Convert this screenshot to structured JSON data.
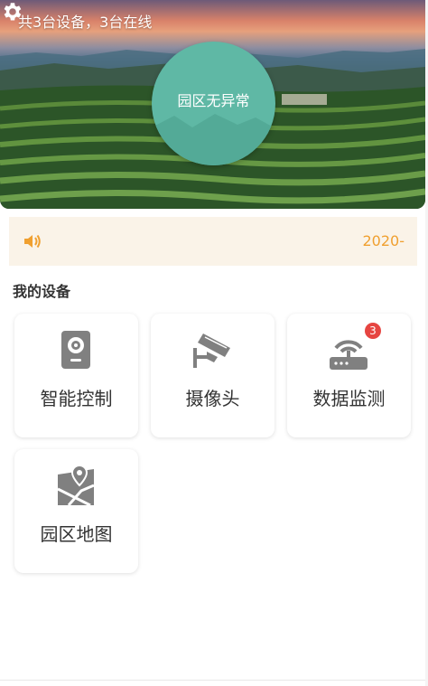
{
  "header": {
    "device_summary": "共3台设备，3台在线",
    "settings_icon": "gear-icon",
    "park_status": "园区无异常"
  },
  "notice": {
    "icon": "speaker-icon",
    "text": "2020-",
    "color": "#f0a030"
  },
  "my_devices": {
    "title": "我的设备",
    "items": [
      {
        "label": "智能控制",
        "icon": "smart-control-icon"
      },
      {
        "label": "摄像头",
        "icon": "camera-icon"
      },
      {
        "label": "数据监测",
        "icon": "router-icon",
        "badge": "3"
      },
      {
        "label": "园区地图",
        "icon": "map-icon"
      }
    ]
  },
  "colors": {
    "accent_teal": "#5fb8a5",
    "badge_red": "#e64541",
    "icon_gray": "#808080",
    "notice_bg": "#faf3e8"
  }
}
